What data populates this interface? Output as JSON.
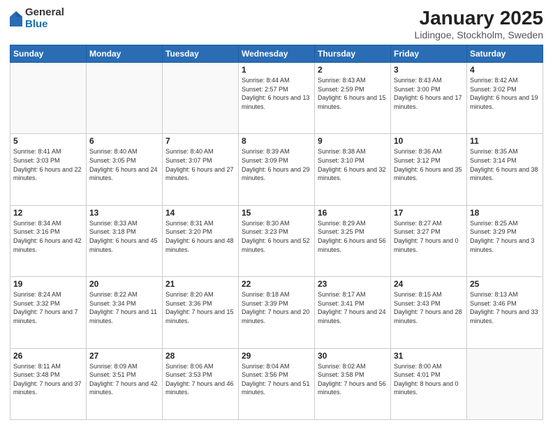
{
  "logo": {
    "general": "General",
    "blue": "Blue"
  },
  "title": "January 2025",
  "subtitle": "Lidingoe, Stockholm, Sweden",
  "weekdays": [
    "Sunday",
    "Monday",
    "Tuesday",
    "Wednesday",
    "Thursday",
    "Friday",
    "Saturday"
  ],
  "weeks": [
    [
      {
        "day": null
      },
      {
        "day": null
      },
      {
        "day": null
      },
      {
        "day": 1,
        "sunrise": "Sunrise: 8:44 AM",
        "sunset": "Sunset: 2:57 PM",
        "daylight": "Daylight: 6 hours and 13 minutes."
      },
      {
        "day": 2,
        "sunrise": "Sunrise: 8:43 AM",
        "sunset": "Sunset: 2:59 PM",
        "daylight": "Daylight: 6 hours and 15 minutes."
      },
      {
        "day": 3,
        "sunrise": "Sunrise: 8:43 AM",
        "sunset": "Sunset: 3:00 PM",
        "daylight": "Daylight: 6 hours and 17 minutes."
      },
      {
        "day": 4,
        "sunrise": "Sunrise: 8:42 AM",
        "sunset": "Sunset: 3:02 PM",
        "daylight": "Daylight: 6 hours and 19 minutes."
      }
    ],
    [
      {
        "day": 5,
        "sunrise": "Sunrise: 8:41 AM",
        "sunset": "Sunset: 3:03 PM",
        "daylight": "Daylight: 6 hours and 22 minutes."
      },
      {
        "day": 6,
        "sunrise": "Sunrise: 8:40 AM",
        "sunset": "Sunset: 3:05 PM",
        "daylight": "Daylight: 6 hours and 24 minutes."
      },
      {
        "day": 7,
        "sunrise": "Sunrise: 8:40 AM",
        "sunset": "Sunset: 3:07 PM",
        "daylight": "Daylight: 6 hours and 27 minutes."
      },
      {
        "day": 8,
        "sunrise": "Sunrise: 8:39 AM",
        "sunset": "Sunset: 3:09 PM",
        "daylight": "Daylight: 6 hours and 29 minutes."
      },
      {
        "day": 9,
        "sunrise": "Sunrise: 8:38 AM",
        "sunset": "Sunset: 3:10 PM",
        "daylight": "Daylight: 6 hours and 32 minutes."
      },
      {
        "day": 10,
        "sunrise": "Sunrise: 8:36 AM",
        "sunset": "Sunset: 3:12 PM",
        "daylight": "Daylight: 6 hours and 35 minutes."
      },
      {
        "day": 11,
        "sunrise": "Sunrise: 8:35 AM",
        "sunset": "Sunset: 3:14 PM",
        "daylight": "Daylight: 6 hours and 38 minutes."
      }
    ],
    [
      {
        "day": 12,
        "sunrise": "Sunrise: 8:34 AM",
        "sunset": "Sunset: 3:16 PM",
        "daylight": "Daylight: 6 hours and 42 minutes."
      },
      {
        "day": 13,
        "sunrise": "Sunrise: 8:33 AM",
        "sunset": "Sunset: 3:18 PM",
        "daylight": "Daylight: 6 hours and 45 minutes."
      },
      {
        "day": 14,
        "sunrise": "Sunrise: 8:31 AM",
        "sunset": "Sunset: 3:20 PM",
        "daylight": "Daylight: 6 hours and 48 minutes."
      },
      {
        "day": 15,
        "sunrise": "Sunrise: 8:30 AM",
        "sunset": "Sunset: 3:23 PM",
        "daylight": "Daylight: 6 hours and 52 minutes."
      },
      {
        "day": 16,
        "sunrise": "Sunrise: 8:29 AM",
        "sunset": "Sunset: 3:25 PM",
        "daylight": "Daylight: 6 hours and 56 minutes."
      },
      {
        "day": 17,
        "sunrise": "Sunrise: 8:27 AM",
        "sunset": "Sunset: 3:27 PM",
        "daylight": "Daylight: 7 hours and 0 minutes."
      },
      {
        "day": 18,
        "sunrise": "Sunrise: 8:25 AM",
        "sunset": "Sunset: 3:29 PM",
        "daylight": "Daylight: 7 hours and 3 minutes."
      }
    ],
    [
      {
        "day": 19,
        "sunrise": "Sunrise: 8:24 AM",
        "sunset": "Sunset: 3:32 PM",
        "daylight": "Daylight: 7 hours and 7 minutes."
      },
      {
        "day": 20,
        "sunrise": "Sunrise: 8:22 AM",
        "sunset": "Sunset: 3:34 PM",
        "daylight": "Daylight: 7 hours and 11 minutes."
      },
      {
        "day": 21,
        "sunrise": "Sunrise: 8:20 AM",
        "sunset": "Sunset: 3:36 PM",
        "daylight": "Daylight: 7 hours and 15 minutes."
      },
      {
        "day": 22,
        "sunrise": "Sunrise: 8:18 AM",
        "sunset": "Sunset: 3:39 PM",
        "daylight": "Daylight: 7 hours and 20 minutes."
      },
      {
        "day": 23,
        "sunrise": "Sunrise: 8:17 AM",
        "sunset": "Sunset: 3:41 PM",
        "daylight": "Daylight: 7 hours and 24 minutes."
      },
      {
        "day": 24,
        "sunrise": "Sunrise: 8:15 AM",
        "sunset": "Sunset: 3:43 PM",
        "daylight": "Daylight: 7 hours and 28 minutes."
      },
      {
        "day": 25,
        "sunrise": "Sunrise: 8:13 AM",
        "sunset": "Sunset: 3:46 PM",
        "daylight": "Daylight: 7 hours and 33 minutes."
      }
    ],
    [
      {
        "day": 26,
        "sunrise": "Sunrise: 8:11 AM",
        "sunset": "Sunset: 3:48 PM",
        "daylight": "Daylight: 7 hours and 37 minutes."
      },
      {
        "day": 27,
        "sunrise": "Sunrise: 8:09 AM",
        "sunset": "Sunset: 3:51 PM",
        "daylight": "Daylight: 7 hours and 42 minutes."
      },
      {
        "day": 28,
        "sunrise": "Sunrise: 8:06 AM",
        "sunset": "Sunset: 3:53 PM",
        "daylight": "Daylight: 7 hours and 46 minutes."
      },
      {
        "day": 29,
        "sunrise": "Sunrise: 8:04 AM",
        "sunset": "Sunset: 3:56 PM",
        "daylight": "Daylight: 7 hours and 51 minutes."
      },
      {
        "day": 30,
        "sunrise": "Sunrise: 8:02 AM",
        "sunset": "Sunset: 3:58 PM",
        "daylight": "Daylight: 7 hours and 56 minutes."
      },
      {
        "day": 31,
        "sunrise": "Sunrise: 8:00 AM",
        "sunset": "Sunset: 4:01 PM",
        "daylight": "Daylight: 8 hours and 0 minutes."
      },
      {
        "day": null
      }
    ]
  ]
}
